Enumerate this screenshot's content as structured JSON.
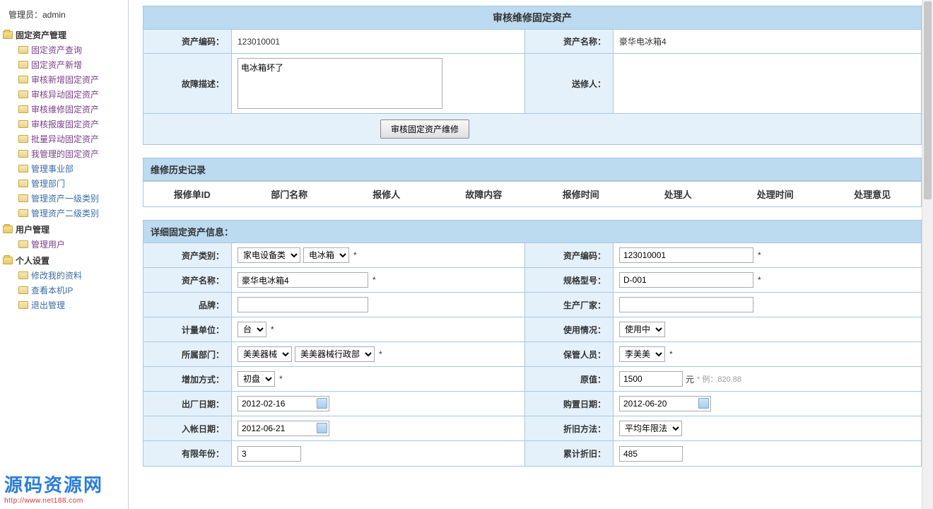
{
  "admin": "管理员：admin",
  "sidebar": {
    "groups": [
      {
        "label": "固定资产管理",
        "items": [
          {
            "label": "固定资产查询",
            "cls": "purple"
          },
          {
            "label": "固定资产新增",
            "cls": "purple"
          },
          {
            "label": "审核新增固定资产",
            "cls": "purple"
          },
          {
            "label": "审核异动固定资产",
            "cls": "purple"
          },
          {
            "label": "审核维修固定资产",
            "cls": "purple"
          },
          {
            "label": "审核报废固定资产",
            "cls": "purple"
          },
          {
            "label": "批量异动固定资产",
            "cls": "purple"
          },
          {
            "label": "我管理的固定资产",
            "cls": "purple"
          },
          {
            "label": "管理事业部",
            "cls": "blue"
          },
          {
            "label": "管理部门",
            "cls": "blue"
          },
          {
            "label": "管理资产一级类别",
            "cls": "blue"
          },
          {
            "label": "管理资产二级类别",
            "cls": "blue"
          }
        ]
      },
      {
        "label": "用户管理",
        "items": [
          {
            "label": "管理用户",
            "cls": "purple"
          }
        ]
      },
      {
        "label": "个人设置",
        "items": [
          {
            "label": "修改我的资料",
            "cls": "blue"
          },
          {
            "label": "查看本机IP",
            "cls": "blue"
          },
          {
            "label": "退出管理",
            "cls": "blue"
          }
        ]
      }
    ]
  },
  "panel1": {
    "title": "审核维修固定资产",
    "row1": {
      "label_l": "资产编码：",
      "value_l": "123010001",
      "label_r": "资产名称：",
      "value_r": "豪华电冰箱4"
    },
    "row2": {
      "label_l": "故障描述：",
      "value_l": "电冰箱坏了",
      "label_r": "送修人："
    },
    "button": "审核固定资产维修"
  },
  "history": {
    "title": "维修历史记录",
    "cols": [
      "报修单ID",
      "部门名称",
      "报修人",
      "故障内容",
      "报修时间",
      "处理人",
      "处理时间",
      "处理意见"
    ]
  },
  "detail": {
    "title": "详细固定资产信息：",
    "rows": [
      {
        "l_label": "资产类别：",
        "l_widgets": [
          {
            "t": "select",
            "v": "家电设备类"
          },
          {
            "t": "select",
            "v": "电冰箱"
          },
          {
            "t": "star"
          }
        ],
        "r_label": "资产编码：",
        "r_widgets": [
          {
            "t": "text",
            "v": "123010001",
            "w": 190
          },
          {
            "t": "star"
          }
        ]
      },
      {
        "l_label": "资产名称：",
        "l_widgets": [
          {
            "t": "text",
            "v": "豪华电冰箱4",
            "w": 185
          },
          {
            "t": "star"
          }
        ],
        "r_label": "规格型号：",
        "r_widgets": [
          {
            "t": "text",
            "v": "D-001",
            "w": 190
          },
          {
            "t": "star"
          }
        ]
      },
      {
        "l_label": "品牌：",
        "l_widgets": [
          {
            "t": "text",
            "v": "",
            "w": 185
          }
        ],
        "r_label": "生产厂家：",
        "r_widgets": [
          {
            "t": "text",
            "v": "",
            "w": 190
          }
        ]
      },
      {
        "l_label": "计量单位：",
        "l_widgets": [
          {
            "t": "select",
            "v": "台"
          },
          {
            "t": "star"
          }
        ],
        "r_label": "使用情况：",
        "r_widgets": [
          {
            "t": "select",
            "v": "使用中"
          }
        ]
      },
      {
        "l_label": "所属部门：",
        "l_widgets": [
          {
            "t": "select",
            "v": "美美器械"
          },
          {
            "t": "select",
            "v": "美美器械行政部"
          },
          {
            "t": "star"
          }
        ],
        "r_label": "保管人员：",
        "r_widgets": [
          {
            "t": "select",
            "v": "李美美"
          },
          {
            "t": "star"
          }
        ]
      },
      {
        "l_label": "增加方式：",
        "l_widgets": [
          {
            "t": "select",
            "v": "初盘"
          },
          {
            "t": "star"
          }
        ],
        "r_label": "原值：",
        "r_widgets": [
          {
            "t": "text",
            "v": "1500",
            "w": 90
          },
          {
            "t": "unit",
            "v": "元"
          },
          {
            "t": "hint",
            "v": "* 例：820.88"
          }
        ]
      },
      {
        "l_label": "出厂日期：",
        "l_widgets": [
          {
            "t": "date",
            "v": "2012-02-16"
          }
        ],
        "r_label": "购置日期：",
        "r_widgets": [
          {
            "t": "date",
            "v": "2012-06-20"
          }
        ]
      },
      {
        "l_label": "入帐日期：",
        "l_widgets": [
          {
            "t": "date",
            "v": "2012-06-21"
          }
        ],
        "r_label": "折旧方法：",
        "r_widgets": [
          {
            "t": "select",
            "v": "平均年限法"
          }
        ]
      },
      {
        "l_label": "有限年份：",
        "l_widgets": [
          {
            "t": "text",
            "v": "3",
            "w": 90
          }
        ],
        "r_label": "累计折旧：",
        "r_widgets": [
          {
            "t": "text",
            "v": "485",
            "w": 90
          }
        ]
      }
    ]
  },
  "watermark": {
    "text": "源码资源网",
    "url": "http://www.net188.com"
  }
}
